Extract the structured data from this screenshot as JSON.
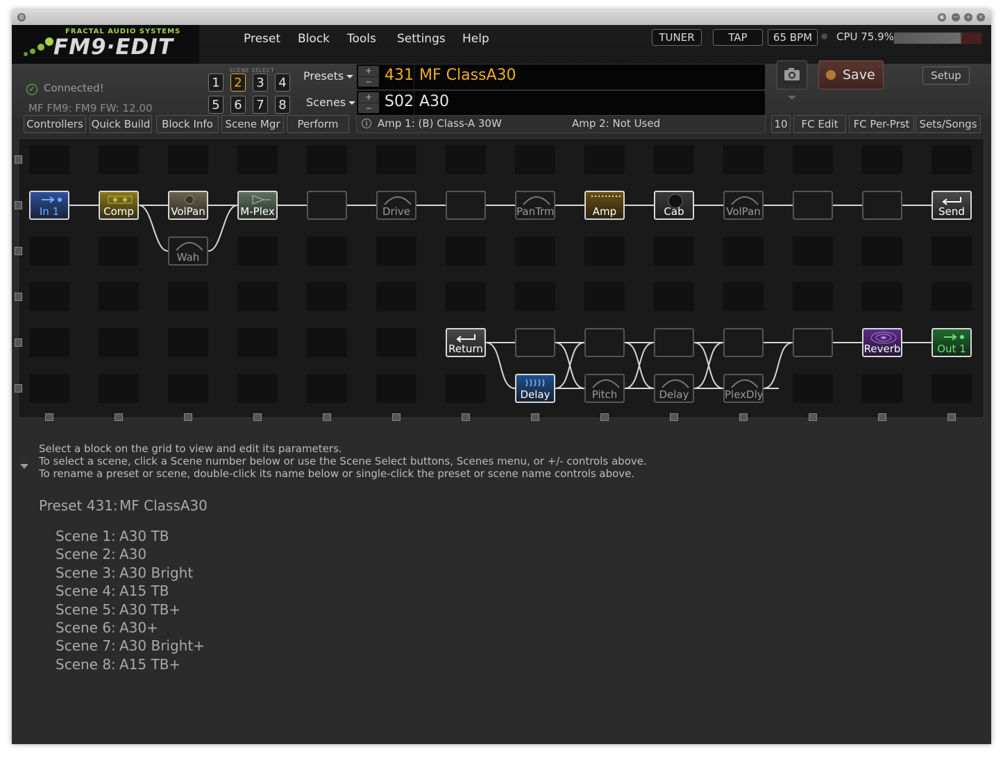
{
  "app": {
    "logo_small": "FRACTAL AUDIO SYSTEMS",
    "logo_big": "FM9·EDIT"
  },
  "menu": [
    "Preset",
    "Block",
    "Tools",
    "Settings",
    "Help"
  ],
  "header_buttons": {
    "tuner": "TUNER",
    "tap": "TAP",
    "bpm": "65 BPM"
  },
  "cpu": {
    "label": "CPU 75.9%",
    "percent": 75.9
  },
  "status": {
    "connected": "Connected!",
    "firmware": "MF FM9: FM9 FW: 12.00"
  },
  "scene_select": {
    "label": "SCENE SELECT",
    "buttons": [
      "1",
      "2",
      "3",
      "4",
      "5",
      "6",
      "7",
      "8"
    ],
    "active": "2"
  },
  "presets_label": "Presets",
  "scenes_label": "Scenes",
  "preset": {
    "number": "431",
    "name": "MF ClassA30",
    "color": "#f0b020"
  },
  "scene": {
    "number": "S02",
    "name": "A30",
    "color": "#e8e8e8"
  },
  "pm_symbols": {
    "plus": "+",
    "minus": "−"
  },
  "save_label": "Save",
  "setup_label": "Setup",
  "tabs_left": [
    "Controllers",
    "Quick Build",
    "Block Info",
    "Scene Mgr",
    "Perform"
  ],
  "info": {
    "amp1": "Amp 1: (B) Class-A 30W",
    "amp2": "Amp 2: Not Used"
  },
  "tabs_right": [
    "10",
    "FC Edit",
    "FC Per-Prst",
    "Sets/Songs"
  ],
  "grid_blocks": [
    {
      "label": "In 1",
      "color": "#2f4f9a",
      "text": "#6fb0ff",
      "icon": "arrow-right-icon"
    },
    {
      "label": "Comp",
      "color": "#8a7a1a",
      "text": "#ffffff",
      "icon": "compressor-icon"
    },
    {
      "label": "VolPan",
      "color": "#6b6450",
      "text": "#ffffff",
      "icon": "knob-icon"
    },
    {
      "label": "M-Plex",
      "color": "#5f7060",
      "text": "#ffffff",
      "icon": "multiplexer-icon"
    },
    {
      "label": "Wah",
      "color": "#1a1a1a",
      "text": "#9a9a9a",
      "icon": ""
    },
    {
      "label": "Drive",
      "color": "#1a1a1a",
      "text": "#9a9a9a",
      "icon": ""
    },
    {
      "label": "PanTrm",
      "color": "#1a1a1a",
      "text": "#9a9a9a",
      "icon": ""
    },
    {
      "label": "Amp",
      "color": "#6a5010",
      "text": "#ffffff",
      "icon": "amp-icon"
    },
    {
      "label": "Cab",
      "color": "#3a3a3a",
      "text": "#ffffff",
      "icon": "speaker-icon"
    },
    {
      "label": "VolPan",
      "color": "#1a1a1a",
      "text": "#9a9a9a",
      "icon": ""
    },
    {
      "label": "Send",
      "color": "#4a4a4a",
      "text": "#ffffff",
      "icon": "return-arrow-icon"
    },
    {
      "label": "Return",
      "color": "#4a4a4a",
      "text": "#ffffff",
      "icon": "return-arrow-icon"
    },
    {
      "label": "Delay",
      "color": "#1f4e8c",
      "text": "#ffffff",
      "icon": "delay-icon"
    },
    {
      "label": "Pitch",
      "color": "#1a1a1a",
      "text": "#9a9a9a",
      "icon": ""
    },
    {
      "label": "Delay",
      "color": "#1a1a1a",
      "text": "#9a9a9a",
      "icon": ""
    },
    {
      "label": "PlexDly",
      "color": "#1a1a1a",
      "text": "#9a9a9a",
      "icon": ""
    },
    {
      "label": "Reverb",
      "color": "#5a2a8a",
      "text": "#ffffff",
      "icon": "reverb-icon"
    },
    {
      "label": "Out 1",
      "color": "#1f6a2f",
      "text": "#6ee07a",
      "icon": "arrow-right-icon"
    }
  ],
  "help_text": [
    "Select a block on the grid to view and edit its parameters.",
    "To select a scene, click a Scene number below or use the Scene Select buttons, Scenes menu, or +/- controls above.",
    "To rename a preset or scene, double-click its name below or single-click the preset or scene name controls above."
  ],
  "preset_summary": {
    "label": "Preset 431:",
    "name": "MF ClassA30"
  },
  "scene_list": [
    {
      "label": "Scene 1:",
      "name": "A30 TB"
    },
    {
      "label": "Scene 2:",
      "name": "A30"
    },
    {
      "label": "Scene 3:",
      "name": "A30 Bright"
    },
    {
      "label": "Scene 4:",
      "name": "A15 TB"
    },
    {
      "label": "Scene 5:",
      "name": "A30 TB+"
    },
    {
      "label": "Scene 6:",
      "name": "A30+"
    },
    {
      "label": "Scene 7:",
      "name": "A30 Bright+"
    },
    {
      "label": "Scene 8:",
      "name": "A15 TB+"
    }
  ]
}
